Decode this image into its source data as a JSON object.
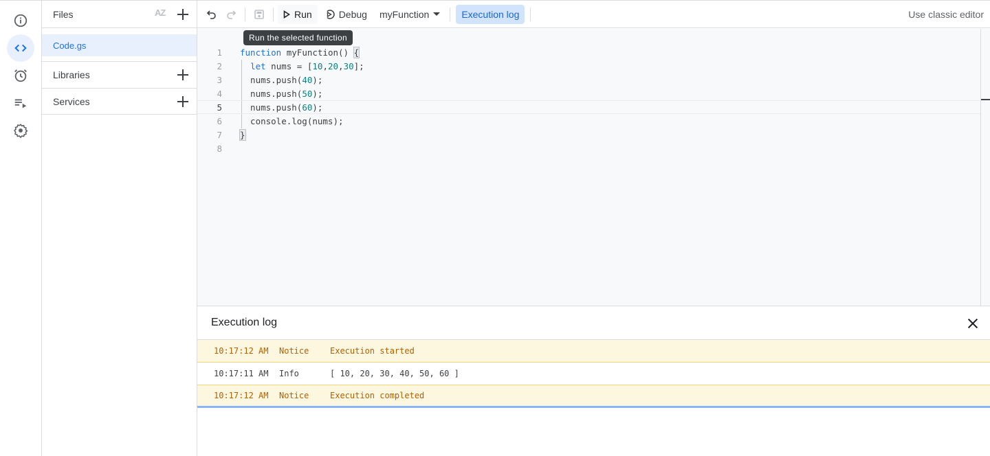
{
  "rail": {
    "items": [
      {
        "name": "overview",
        "icon": "info-icon",
        "active": false
      },
      {
        "name": "editor",
        "icon": "code-icon",
        "active": true
      },
      {
        "name": "triggers",
        "icon": "alarm-icon",
        "active": false
      },
      {
        "name": "executions",
        "icon": "executions-icon",
        "active": false
      },
      {
        "name": "settings",
        "icon": "gear-icon",
        "active": false
      }
    ]
  },
  "files_panel": {
    "title": "Files",
    "sort_icon": "AZ",
    "files": [
      {
        "name": "Code.gs",
        "selected": true
      }
    ],
    "sections": [
      {
        "label": "Libraries"
      },
      {
        "label": "Services"
      }
    ]
  },
  "toolbar": {
    "run_label": "Run",
    "debug_label": "Debug",
    "function_selected": "myFunction",
    "execution_log_label": "Execution log",
    "classic_editor_label": "Use classic editor"
  },
  "tooltip": {
    "text": "Run the selected function"
  },
  "editor": {
    "current_line": 5,
    "lines": [
      {
        "n": "1",
        "text": "function myFunction() {"
      },
      {
        "n": "2",
        "text": "  let nums = [10,20,30];"
      },
      {
        "n": "3",
        "text": "  nums.push(40);"
      },
      {
        "n": "4",
        "text": "  nums.push(50);"
      },
      {
        "n": "5",
        "text": "  nums.push(60);"
      },
      {
        "n": "6",
        "text": "  console.log(nums);"
      },
      {
        "n": "7",
        "text": "}"
      },
      {
        "n": "8",
        "text": ""
      }
    ]
  },
  "execution_log": {
    "title": "Execution log",
    "rows": [
      {
        "time": "10:17:12 AM",
        "severity": "Notice",
        "message": "Execution started"
      },
      {
        "time": "10:17:11 AM",
        "severity": "Info",
        "message": "[ 10, 20, 30, 40, 50, 60 ]"
      },
      {
        "time": "10:17:12 AM",
        "severity": "Notice",
        "message": "Execution completed"
      }
    ]
  },
  "colors": {
    "accent": "#1a73e8",
    "notice_bg": "#fef7e0",
    "notice_text": "#b06000",
    "active_bg": "#e8f0fe"
  }
}
